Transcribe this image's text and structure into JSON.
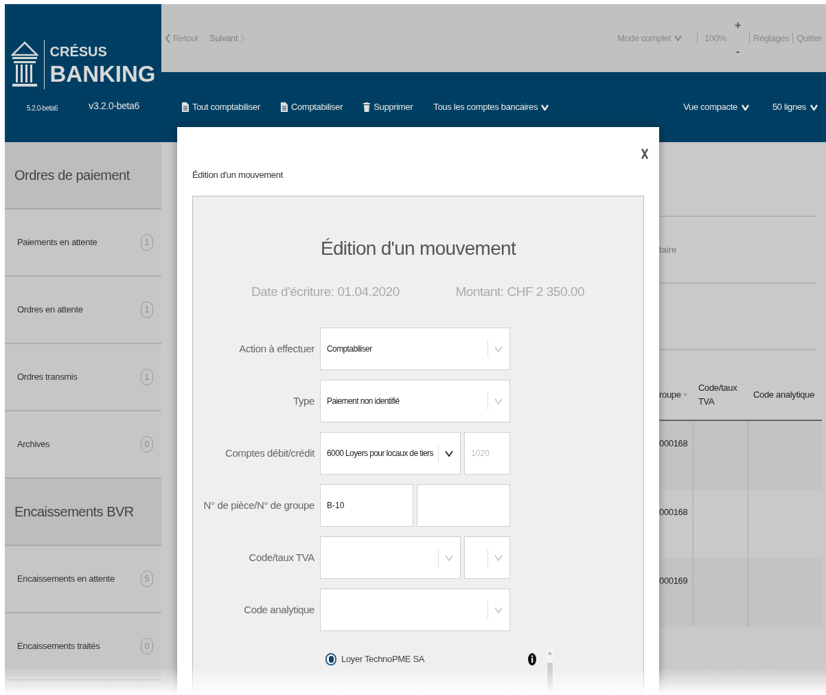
{
  "app": {
    "name_top": "CRÉSUS",
    "name_bottom": "BANKING",
    "version_left": "5.2.0-beta6",
    "version_right": "v3.2.0-beta6"
  },
  "nav": {
    "back": "Retour",
    "forward": "Suivant",
    "forward_disabled": true,
    "mode": "Mode complet",
    "zoom": "100%",
    "zoom_in": "+",
    "zoom_out": "-",
    "settings": "Réglages",
    "quit": "Quitter"
  },
  "toolbar": {
    "left": [
      {
        "label": "Tout comptabiliser",
        "kind": "file"
      },
      {
        "label": "Comptabiliser",
        "kind": "file"
      },
      {
        "label": "Supprimer",
        "kind": "trash"
      },
      {
        "label": "Tous les comptes bancaires",
        "kind": "dropdown"
      }
    ],
    "right": [
      {
        "label": "Vue compacte",
        "kind": "dropdown"
      },
      {
        "label": "50 lignes",
        "kind": "dropdown"
      }
    ]
  },
  "sidebar": {
    "sections": [
      {
        "title": "Ordres de paiement",
        "items": [
          {
            "label": "Paiements en attente",
            "count": "1"
          },
          {
            "label": "Ordres en attente",
            "count": "1"
          },
          {
            "label": "Ordres transmis",
            "count": "1"
          },
          {
            "label": "Archives",
            "count": "0"
          }
        ]
      },
      {
        "title": "Encaissements BVR",
        "items": [
          {
            "label": "Encaissements en attente",
            "count": "5"
          },
          {
            "label": "Encaissements traités",
            "count": "0"
          }
        ]
      }
    ]
  },
  "background": {
    "field_fragment": "taire",
    "table": {
      "columns": [
        "roupe",
        "Code/taux TVA",
        "Code analytique"
      ],
      "rows": [
        {
          "column_1": "000168"
        },
        {
          "column_1": "000168"
        },
        {
          "column_1": "000169"
        }
      ]
    }
  },
  "modal": {
    "caption": "Édition d'un mouvement",
    "title": "Édition d'un mouvement",
    "date": "Date d'écriture: 01.04.2020",
    "amount": "Montant: CHF 2 350.00",
    "fields": [
      {
        "label": "Action à effectuer",
        "kind": "select",
        "value": "Comptabiliser"
      },
      {
        "label": "Type",
        "kind": "select",
        "value": "Paiement non identifié"
      },
      {
        "label": "Comptes débit/crédit",
        "kind": "select_input",
        "value": "6000 Loyers pour locaux de tiers",
        "placeholder": "1020"
      },
      {
        "label": "N° de pièce/N° de groupe",
        "kind": "two_inputs",
        "value": "B-10"
      },
      {
        "label": "Code/taux TVA",
        "kind": "two_selects"
      },
      {
        "label": "Code analytique",
        "kind": "select"
      }
    ],
    "options": [
      {
        "label": "Loyer TechnoPME SA",
        "selected": true
      }
    ]
  }
}
